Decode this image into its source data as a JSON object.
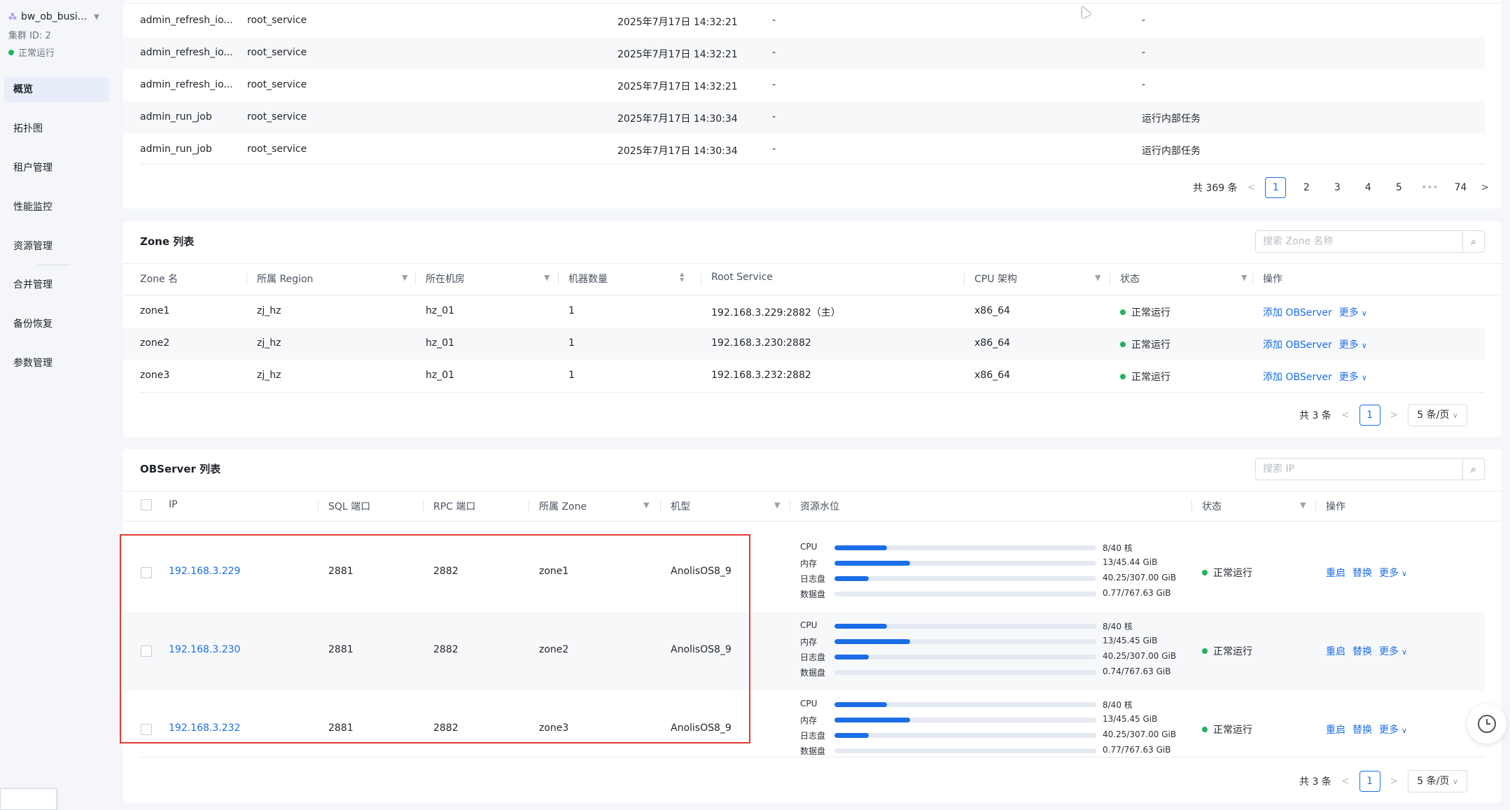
{
  "sidebar": {
    "cluster_name": "bw_ob_busi...",
    "cluster_id": "集群 ID: 2",
    "cluster_status": "正常运行",
    "items": [
      {
        "label": "概览",
        "active": true
      },
      {
        "label": "拓扑图"
      },
      {
        "label": "租户管理"
      },
      {
        "label": "性能监控"
      },
      {
        "label": "资源管理"
      },
      {
        "label": "合并管理"
      },
      {
        "label": "备份恢复"
      },
      {
        "label": "参数管理"
      }
    ]
  },
  "events": {
    "rows": [
      {
        "name": "admin_refresh_io...",
        "module": "root_service",
        "time": "2025年7月17日 14:32:21",
        "c4": "-",
        "desc": "-"
      },
      {
        "name": "admin_refresh_io...",
        "module": "root_service",
        "time": "2025年7月17日 14:32:21",
        "c4": "-",
        "desc": "-"
      },
      {
        "name": "admin_refresh_io...",
        "module": "root_service",
        "time": "2025年7月17日 14:32:21",
        "c4": "-",
        "desc": "-"
      },
      {
        "name": "admin_run_job",
        "module": "root_service",
        "time": "2025年7月17日 14:30:34",
        "c4": "-",
        "desc": "运行内部任务"
      },
      {
        "name": "admin_run_job",
        "module": "root_service",
        "time": "2025年7月17日 14:30:34",
        "c4": "-",
        "desc": "运行内部任务"
      }
    ],
    "total": "共 369 条",
    "pages": [
      "1",
      "2",
      "3",
      "4",
      "5",
      "•••",
      "74"
    ]
  },
  "zones": {
    "title": "Zone 列表",
    "search_placeholder": "搜索 Zone 名称",
    "headers": [
      "Zone 名",
      "所属 Region",
      "所在机房",
      "机器数量",
      "Root Service",
      "CPU 架构",
      "状态",
      "操作"
    ],
    "rows": [
      {
        "zone": "zone1",
        "region": "zj_hz",
        "idc": "hz_01",
        "count": "1",
        "rs": "192.168.3.229:2882（主）",
        "cpu": "x86_64",
        "status": "正常运行"
      },
      {
        "zone": "zone2",
        "region": "zj_hz",
        "idc": "hz_01",
        "count": "1",
        "rs": "192.168.3.230:2882",
        "cpu": "x86_64",
        "status": "正常运行"
      },
      {
        "zone": "zone3",
        "region": "zj_hz",
        "idc": "hz_01",
        "count": "1",
        "rs": "192.168.3.232:2882",
        "cpu": "x86_64",
        "status": "正常运行"
      }
    ],
    "action_add": "添加 OBServer",
    "action_more": "更多",
    "total": "共 3 条",
    "page": "1",
    "page_size": "5 条/页"
  },
  "observers": {
    "title": "OBServer 列表",
    "search_placeholder": "搜索 IP",
    "headers": [
      "IP",
      "SQL 端口",
      "RPC 端口",
      "所属 Zone",
      "机型",
      "资源水位",
      "状态",
      "操作"
    ],
    "resource_labels": [
      "CPU",
      "内存",
      "日志盘",
      "数据盘"
    ],
    "rows": [
      {
        "ip": "192.168.3.229",
        "sql": "2881",
        "rpc": "2882",
        "zone": "zone1",
        "model": "AnolisOS8_9",
        "res": [
          {
            "val": "8/40 核",
            "pct": 0.2
          },
          {
            "val": "13/45.44 GiB",
            "pct": 0.29
          },
          {
            "val": "40.25/307.00 GiB",
            "pct": 0.13
          },
          {
            "val": "0.77/767.63 GiB",
            "pct": 0.0
          }
        ],
        "status": "正常运行"
      },
      {
        "ip": "192.168.3.230",
        "sql": "2881",
        "rpc": "2882",
        "zone": "zone2",
        "model": "AnolisOS8_9",
        "res": [
          {
            "val": "8/40 核",
            "pct": 0.2
          },
          {
            "val": "13/45.45 GiB",
            "pct": 0.29
          },
          {
            "val": "40.25/307.00 GiB",
            "pct": 0.13
          },
          {
            "val": "0.74/767.63 GiB",
            "pct": 0.0
          }
        ],
        "status": "正常运行"
      },
      {
        "ip": "192.168.3.232",
        "sql": "2881",
        "rpc": "2882",
        "zone": "zone3",
        "model": "AnolisOS8_9",
        "res": [
          {
            "val": "8/40 核",
            "pct": 0.2
          },
          {
            "val": "13/45.45 GiB",
            "pct": 0.29
          },
          {
            "val": "40.25/307.00 GiB",
            "pct": 0.13
          },
          {
            "val": "0.77/767.63 GiB",
            "pct": 0.0
          }
        ],
        "status": "正常运行"
      }
    ],
    "action_restart": "重启",
    "action_replace": "替换",
    "action_more": "更多",
    "total": "共 3 条",
    "page": "1",
    "page_size": "5 条/页"
  },
  "colors": {
    "accent": "#1a6ee6",
    "success": "#22b35e",
    "highlight": "#e53935"
  }
}
